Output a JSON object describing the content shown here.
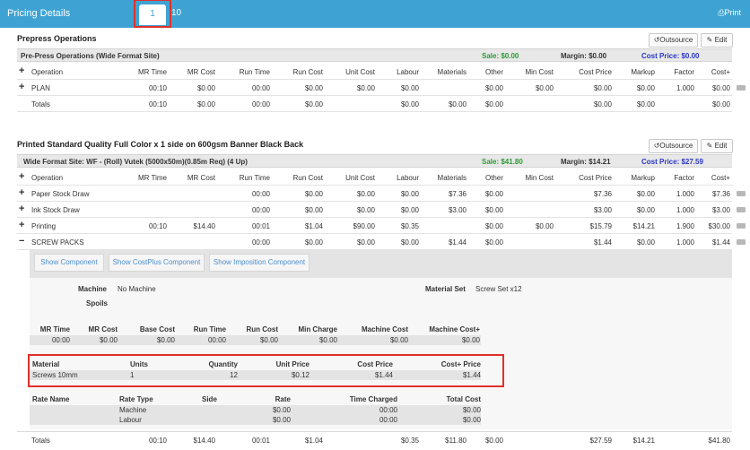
{
  "topbar": {
    "title": "Pricing Details",
    "tab_active": "1",
    "tab_other": "10",
    "print": "⎙Print"
  },
  "section1": {
    "title": "Prepress Operations",
    "outsource_btn": "↺Outsource",
    "edit_btn": "✎ Edit",
    "bar": {
      "name": "Pre-Press Operations (Wide Format Site)",
      "sale": "Sale: $0.00",
      "margin": "Margin: $0.00",
      "cost_price": "Cost Price: $0.00"
    },
    "headers": [
      "Operation",
      "MR Time",
      "MR Cost",
      "Run Time",
      "Run Cost",
      "Unit Cost",
      "Labour",
      "Materials",
      "Other",
      "Min Cost",
      "Cost Price",
      "Markup",
      "Factor",
      "Cost+"
    ],
    "rows": [
      {
        "sign": "+",
        "cells": [
          "PLAN",
          "00:10",
          "$0.00",
          "00:00",
          "$0.00",
          "$0.00",
          "$0.00",
          "",
          "$0.00",
          "$0.00",
          "$0.00",
          "$0.00",
          "1.000",
          "$0.00"
        ]
      }
    ],
    "totals": [
      "Totals",
      "00:10",
      "$0.00",
      "00:00",
      "$0.00",
      "",
      "$0.00",
      "$0.00",
      "$0.00",
      "",
      "$0.00",
      "$0.00",
      "",
      "$0.00"
    ]
  },
  "section2": {
    "title": "Printed Standard Quality Full Color x 1 side on 600gsm Banner Black Back",
    "outsource_btn": "↺Outsource",
    "edit_btn": "✎ Edit",
    "bar": {
      "name": "Wide Format Site: WF - (Roll) Vutek (5000x50m)(0.85m Req) (4 Up)",
      "sale": "Sale: $41.80",
      "margin": "Margin: $14.21",
      "cost_price": "Cost Price: $27.59"
    },
    "headers": [
      "Operation",
      "MR Time",
      "MR Cost",
      "Run Time",
      "Run Cost",
      "Unit Cost",
      "Labour",
      "Materials",
      "Other",
      "Min Cost",
      "Cost Price",
      "Markup",
      "Factor",
      "Cost+"
    ],
    "rows": [
      {
        "sign": "+",
        "cells": [
          "Paper Stock Draw",
          "",
          "",
          "00:00",
          "$0.00",
          "$0.00",
          "$0.00",
          "$7.36",
          "$0.00",
          "",
          "$7.36",
          "$0.00",
          "1.000",
          "$7.36"
        ]
      },
      {
        "sign": "+",
        "cells": [
          "Ink Stock Draw",
          "",
          "",
          "00:00",
          "$0.00",
          "$0.00",
          "$0.00",
          "$3.00",
          "$0.00",
          "",
          "$3.00",
          "$0.00",
          "1.000",
          "$3.00"
        ]
      },
      {
        "sign": "+",
        "cells": [
          "Printing",
          "00:10",
          "$14.40",
          "00:01",
          "$1.04",
          "$90.00",
          "$0.35",
          "",
          "$0.00",
          "$0.00",
          "$15.79",
          "$14.21",
          "1.900",
          "$30.00"
        ]
      },
      {
        "sign": "−",
        "cells": [
          "SCREW PACKS",
          "",
          "",
          "00:00",
          "$0.00",
          "$0.00",
          "$0.00",
          "$1.44",
          "$0.00",
          "",
          "$1.44",
          "$0.00",
          "1.000",
          "$1.44"
        ]
      }
    ],
    "totals": [
      "Totals",
      "00:10",
      "$14.40",
      "00:01",
      "$1.04",
      "",
      "$0.35",
      "$11.80",
      "$0.00",
      "",
      "$27.59",
      "$14.21",
      "",
      "$41.80"
    ]
  },
  "detail": {
    "buttons": [
      "Show Component",
      "Show CostPlus Component",
      "Show Imposition Component"
    ],
    "machine_label": "Machine",
    "machine_value": "No Machine",
    "spoils_label": "Spoils",
    "material_set_label": "Material Set",
    "material_set_value": "Screw Set x12",
    "mr_headers": [
      "MR Time",
      "MR Cost",
      "Base Cost",
      "Run Time",
      "Run Cost",
      "Min Charge",
      "Machine Cost",
      "Machine Cost+"
    ],
    "mr_values": [
      "00:00",
      "$0.00",
      "$0.00",
      "00:00",
      "$0.00",
      "$0.00",
      "$0.00",
      "$0.00"
    ],
    "mat_headers": [
      "Material",
      "Units",
      "Quantity",
      "Unit Price",
      "Cost Price",
      "Cost+ Price"
    ],
    "mat_values": [
      "Screws 10mm",
      "1",
      "12",
      "$0.12",
      "$1.44",
      "$1.44"
    ],
    "rate_headers": [
      "Rate Name",
      "Rate Type",
      "Side",
      "Rate",
      "Time Charged",
      "Total Cost"
    ],
    "rate_rows": [
      [
        "",
        "Machine",
        "",
        "$0.00",
        "00:00",
        "$0.00"
      ],
      [
        "",
        "Labour",
        "",
        "$0.00",
        "00:00",
        "$0.00"
      ]
    ]
  },
  "colors": {
    "accent": "#3ea3d3",
    "green": "#2c9a34",
    "blue": "#2a35c9",
    "highlight": "#e0302a"
  }
}
